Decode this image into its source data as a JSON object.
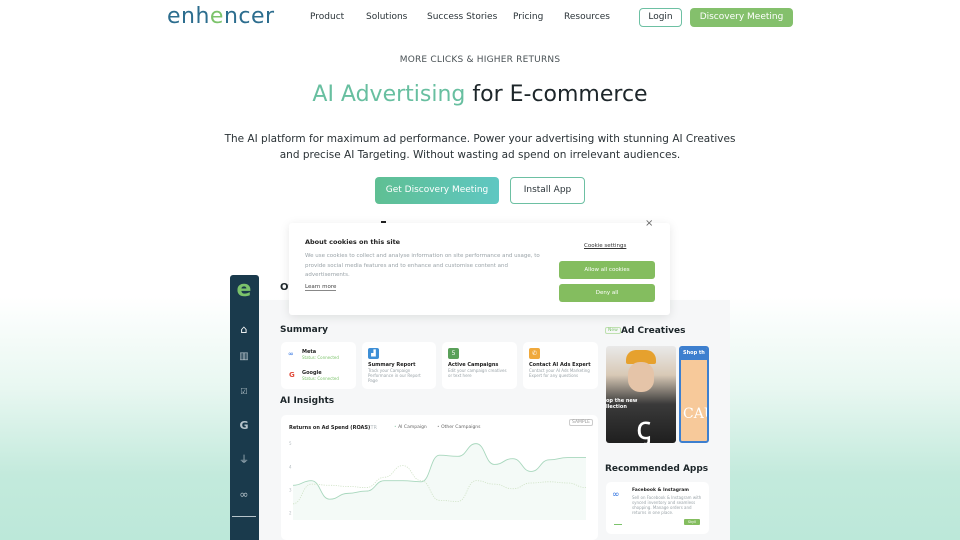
{
  "nav": {
    "logo": "enhancer",
    "links": [
      "Product",
      "Solutions",
      "Success Stories",
      "Pricing",
      "Resources"
    ],
    "login": "Login",
    "discovery": "Discovery Meeting"
  },
  "hero": {
    "eyebrow": "MORE CLICKS & HIGHER RETURNS",
    "headline_accent": "AI Advertising",
    "headline_rest": " for E-commerce",
    "sub_line1": "The AI platform for maximum ad performance. Power your advertising with stunning AI Creatives",
    "sub_line2": "and precise AI Targeting. Without wasting ad spend on irrelevant audiences.",
    "cta_primary": "Get Discovery Meeting",
    "cta_secondary": "Install App"
  },
  "colors": {
    "brand_green": "#84c06c",
    "brand_teal": "#68bfa0",
    "sidebar": "#1a3a4c",
    "logo_blue": "#2c6d8e"
  },
  "dashboard": {
    "heading": "Ov",
    "sidebar_icons": [
      "home-icon",
      "chart-icon",
      "checkbox-icon",
      "google-icon",
      "plug-icon",
      "infinity-icon"
    ],
    "summary_title": "Summary",
    "connections": [
      {
        "name": "Meta",
        "status": "Status: Connected"
      },
      {
        "name": "Google",
        "status": "Status: Connected"
      }
    ],
    "cards": [
      {
        "title": "Summary Report",
        "desc": "Track your Campaign Performance in our Report Page",
        "icon": "chart-icon",
        "color": "#3e8fd6"
      },
      {
        "title": "Active Campaigns",
        "desc": "Edit your campaign creatives or text here",
        "icon": "5",
        "color": "#5aa05a"
      },
      {
        "title": "Contact AI Ads Expert",
        "desc": "Contact your AI Ads Marketing Expert for any questions",
        "icon": "phone-icon",
        "color": "#f0a93c"
      }
    ],
    "insights_title": "AI Insights",
    "ad_creatives_badge": "New",
    "ad_creatives_title": "Ad Creatives",
    "creative_1_text": "op the new\nllection",
    "creative_2_text": "Shop th",
    "recommended_title": "Recommended Apps",
    "app": {
      "name": "Facebook & Instagram",
      "desc": "Sell on Facebook & Instagram with synced inventory and seamless shopping. Manage orders and returns in one place.",
      "button": "Skyll"
    }
  },
  "chart_data": {
    "type": "line",
    "title": "Returns on Ad Spend (ROAS)",
    "alt_tab": "CTR",
    "badge": "SAMPLE",
    "legend_position": "top",
    "yticks": [
      "5",
      "4",
      "3",
      "2"
    ],
    "ylim": [
      1.7,
      5.2
    ],
    "x": [
      0,
      1,
      2,
      3,
      4,
      5,
      6,
      7,
      8,
      9,
      10,
      11,
      12,
      13,
      14,
      15,
      16
    ],
    "series": [
      {
        "name": "AI Campaign",
        "style": "solid",
        "color": "#a8d7bd",
        "values": [
          3.2,
          3.4,
          2.6,
          2.85,
          2.95,
          3.4,
          3.4,
          3.35,
          4.5,
          4.45,
          5.0,
          4.1,
          4.35,
          3.8,
          4.3,
          4.4,
          4.4
        ]
      },
      {
        "name": "Other Campaigns",
        "style": "dashed",
        "color": "#cfe2c6",
        "values": [
          2.4,
          3.25,
          3.2,
          3.15,
          3.1,
          3.55,
          4.05,
          3.4,
          2.55,
          2.5,
          3.4,
          3.25,
          3.05,
          3.3,
          3.35,
          3.3,
          3.1
        ]
      }
    ]
  },
  "cookie": {
    "title": "About cookies on this site",
    "text": "We use cookies to collect and analyse information on site performance and usage, to provide social media features and to enhance and customise content and advertisements.",
    "learn_more": "Learn more",
    "settings": "Cookie settings",
    "allow": "Allow all cookies",
    "deny": "Deny all",
    "close": "×"
  }
}
